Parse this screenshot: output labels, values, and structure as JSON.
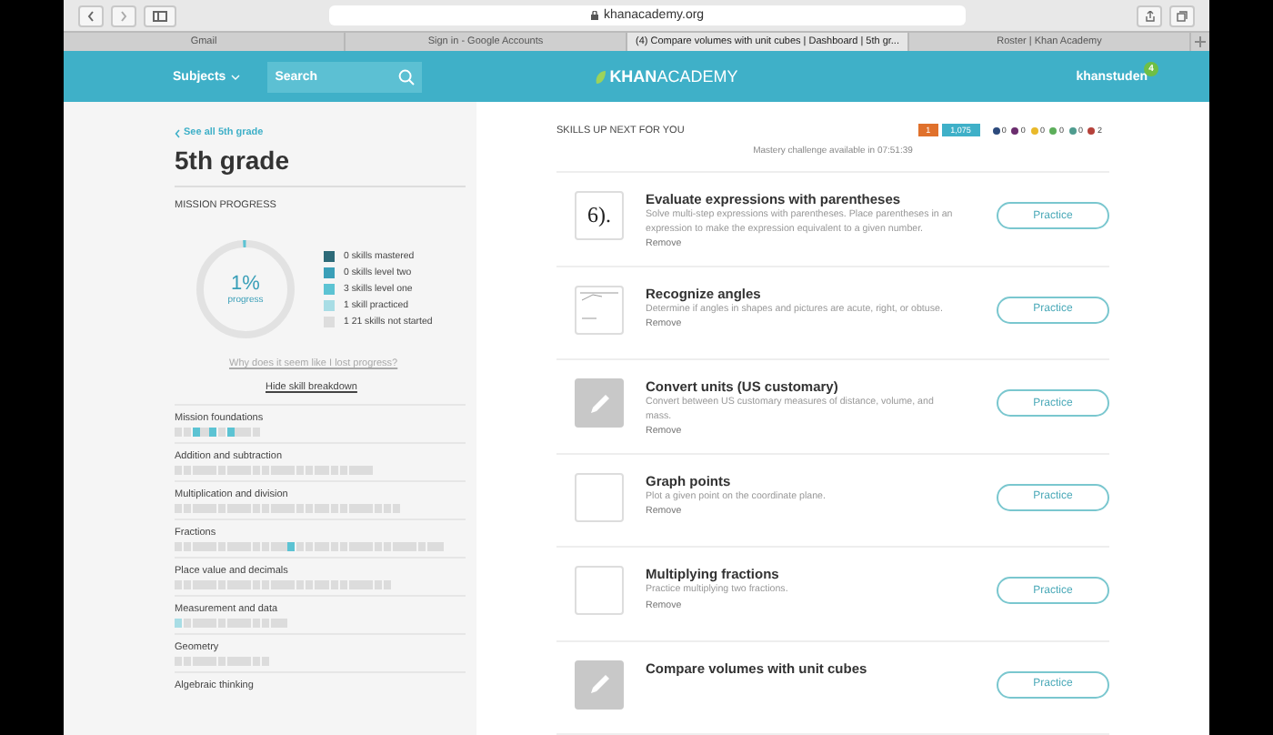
{
  "browser": {
    "url": "khanacademy.org",
    "tabs": [
      {
        "label": "Gmail",
        "selected": false
      },
      {
        "label": "Sign in - Google Accounts",
        "selected": false
      },
      {
        "label": "(4) Compare volumes with unit cubes | Dashboard | 5th gr...",
        "selected": true
      },
      {
        "label": "Roster | Khan Academy",
        "selected": false
      }
    ]
  },
  "header": {
    "subjects": "Subjects",
    "search": {
      "placeholder": "Search"
    },
    "logo": "**KHAN**ACADEMY",
    "user": "khanstuden",
    "notification_count": "4"
  },
  "sidebar": {
    "back_link": "See all 5th grade",
    "title": "5th grade",
    "section": "MISSION PROGRESS",
    "progress": {
      "level": 0.01,
      "percent": "1%",
      "label": "progress"
    },
    "legend": [
      {
        "text": "0 skills mastered",
        "color": "#2d6a78"
      },
      {
        "text": "0 skills level two",
        "color": "#3a9fb8"
      },
      {
        "text": "3 skills level one",
        "color": "#5cc3d3"
      },
      {
        "text": "1 skill practiced",
        "color": "#a8dde5"
      },
      {
        "text": "1 21 skills not started",
        "color": "#dddddd"
      }
    ],
    "lost_progress_link": "Why does it seem like I lost progress?",
    "breakdown_link": "Hide skill breakdown",
    "topics": [
      {
        "name": "Mission foundations",
        "squares": [
          {
            "kind": "none"
          },
          {
            "kind": "none"
          },
          {
            "kind": "level_one"
          },
          {
            "kind": "none"
          },
          {
            "kind": "level_one"
          },
          {
            "kind": "none"
          },
          {
            "kind": "level_one"
          },
          {
            "kind": "none"
          },
          {
            "kind": "none"
          },
          {
            "kind": "none"
          }
        ]
      },
      {
        "name": "Addition and subtraction",
        "squares": [
          {
            "kind": "none"
          },
          {
            "kind": "none"
          },
          {
            "kind": "none"
          },
          {
            "kind": "none"
          },
          {
            "kind": "none"
          },
          {
            "kind": "none"
          },
          {
            "kind": "none"
          },
          {
            "kind": "none"
          },
          {
            "kind": "none"
          },
          {
            "kind": "none"
          },
          {
            "kind": "none"
          },
          {
            "kind": "none"
          },
          {
            "kind": "none"
          },
          {
            "kind": "none"
          },
          {
            "kind": "none"
          },
          {
            "kind": "none"
          },
          {
            "kind": "none"
          },
          {
            "kind": "none"
          },
          {
            "kind": "none"
          },
          {
            "kind": "none"
          },
          {
            "kind": "none"
          },
          {
            "kind": "none"
          },
          {
            "kind": "none"
          }
        ]
      },
      {
        "name": "Multiplication and division",
        "squares": [
          {
            "kind": "none"
          },
          {
            "kind": "none"
          },
          {
            "kind": "none"
          },
          {
            "kind": "none"
          },
          {
            "kind": "none"
          },
          {
            "kind": "none"
          },
          {
            "kind": "none"
          },
          {
            "kind": "none"
          },
          {
            "kind": "none"
          },
          {
            "kind": "none"
          },
          {
            "kind": "none"
          },
          {
            "kind": "none"
          },
          {
            "kind": "none"
          },
          {
            "kind": "none"
          },
          {
            "kind": "none"
          },
          {
            "kind": "none"
          },
          {
            "kind": "none"
          },
          {
            "kind": "none"
          },
          {
            "kind": "none"
          },
          {
            "kind": "none"
          },
          {
            "kind": "none"
          },
          {
            "kind": "none"
          },
          {
            "kind": "none"
          },
          {
            "kind": "none"
          },
          {
            "kind": "none"
          },
          {
            "kind": "none"
          }
        ]
      },
      {
        "name": "Fractions",
        "squares": [
          {
            "kind": "none"
          },
          {
            "kind": "none"
          },
          {
            "kind": "none"
          },
          {
            "kind": "none"
          },
          {
            "kind": "none"
          },
          {
            "kind": "none"
          },
          {
            "kind": "none"
          },
          {
            "kind": "none"
          },
          {
            "kind": "none"
          },
          {
            "kind": "none"
          },
          {
            "kind": "none"
          },
          {
            "kind": "none"
          },
          {
            "kind": "none"
          },
          {
            "kind": "level_one"
          },
          {
            "kind": "none"
          },
          {
            "kind": "none"
          },
          {
            "kind": "none"
          },
          {
            "kind": "none"
          },
          {
            "kind": "none"
          },
          {
            "kind": "none"
          },
          {
            "kind": "none"
          },
          {
            "kind": "none"
          },
          {
            "kind": "none"
          },
          {
            "kind": "none"
          },
          {
            "kind": "none"
          },
          {
            "kind": "none"
          },
          {
            "kind": "none"
          },
          {
            "kind": "none"
          },
          {
            "kind": "none"
          },
          {
            "kind": "none"
          },
          {
            "kind": "none"
          }
        ]
      },
      {
        "name": "Place value and decimals",
        "squares": [
          {
            "kind": "none"
          },
          {
            "kind": "none"
          },
          {
            "kind": "none"
          },
          {
            "kind": "none"
          },
          {
            "kind": "none"
          },
          {
            "kind": "none"
          },
          {
            "kind": "none"
          },
          {
            "kind": "none"
          },
          {
            "kind": "none"
          },
          {
            "kind": "none"
          },
          {
            "kind": "none"
          },
          {
            "kind": "none"
          },
          {
            "kind": "none"
          },
          {
            "kind": "none"
          },
          {
            "kind": "none"
          },
          {
            "kind": "none"
          },
          {
            "kind": "none"
          },
          {
            "kind": "none"
          },
          {
            "kind": "none"
          },
          {
            "kind": "none"
          },
          {
            "kind": "none"
          },
          {
            "kind": "none"
          },
          {
            "kind": "none"
          },
          {
            "kind": "none"
          },
          {
            "kind": "none"
          }
        ]
      },
      {
        "name": "Measurement and data",
        "squares": [
          {
            "kind": "practiced"
          },
          {
            "kind": "none"
          },
          {
            "kind": "none"
          },
          {
            "kind": "none"
          },
          {
            "kind": "none"
          },
          {
            "kind": "none"
          },
          {
            "kind": "none"
          },
          {
            "kind": "none"
          },
          {
            "kind": "none"
          },
          {
            "kind": "none"
          },
          {
            "kind": "none"
          },
          {
            "kind": "none"
          },
          {
            "kind": "none"
          }
        ]
      },
      {
        "name": "Geometry",
        "squares": [
          {
            "kind": "none"
          },
          {
            "kind": "none"
          },
          {
            "kind": "none"
          },
          {
            "kind": "none"
          },
          {
            "kind": "none"
          },
          {
            "kind": "none"
          },
          {
            "kind": "none"
          },
          {
            "kind": "none"
          },
          {
            "kind": "none"
          },
          {
            "kind": "none"
          },
          {
            "kind": "none"
          }
        ]
      },
      {
        "name": "Algebraic thinking"
      }
    ]
  },
  "main": {
    "section": "SKILLS UP NEXT FOR YOU",
    "streak": "1",
    "points": "1,075",
    "badges": [
      {
        "count": "0",
        "color": "#2c4a7c"
      },
      {
        "count": "0",
        "color": "#6b2d6e"
      },
      {
        "count": "0",
        "color": "#e9b92a"
      },
      {
        "count": "0",
        "color": "#5cae5a"
      },
      {
        "count": "0",
        "color": "#4f9c8f"
      },
      {
        "count": "2",
        "color": "#b5413a"
      }
    ],
    "mastery_note": "Mastery challenge available in 07:51:39",
    "skills": [
      {
        "kind": "text",
        "thumb_text": "6).",
        "title": "Evaluate expressions with parentheses",
        "description": "Solve multi-step expressions with parentheses.  Place parentheses in an expression to make the expression equivalent to a given number.",
        "remove": "Remove",
        "action": "Practice"
      },
      {
        "kind": "diagram",
        "title": "Recognize angles",
        "description": "Determine if angles in shapes and pictures are acute, right, or obtuse.",
        "remove": "Remove",
        "action": "Practice"
      },
      {
        "kind": "pencil",
        "title": "Convert units (US customary)",
        "description": "Convert between US customary measures of distance, volume, and mass.",
        "remove": "Remove",
        "action": "Practice"
      },
      {
        "kind": "blank",
        "title": "Graph points",
        "description": "Plot a given point on the coordinate plane.",
        "remove": "Remove",
        "action": "Practice"
      },
      {
        "kind": "blank",
        "title": "Multiplying fractions",
        "description": "Practice multiplying two fractions.",
        "remove": "Remove",
        "action": "Practice"
      },
      {
        "kind": "pencil",
        "title": "Compare volumes with unit cubes",
        "action": "Practice"
      }
    ]
  }
}
